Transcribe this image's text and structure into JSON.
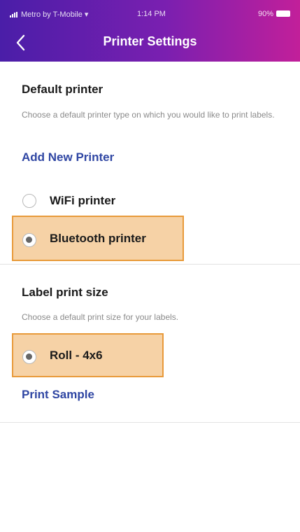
{
  "status_bar": {
    "carrier": "Metro by T-Mobile",
    "time": "1:14 PM",
    "battery": "90%"
  },
  "header": {
    "title": "Printer Settings"
  },
  "default_printer": {
    "heading": "Default printer",
    "description": "Choose a default printer type on which you would like to print labels.",
    "add_link": "Add New Printer",
    "options": [
      {
        "label": "WiFi printer",
        "selected": false
      },
      {
        "label": "Bluetooth printer",
        "selected": true
      }
    ]
  },
  "label_size": {
    "heading": "Label print size",
    "description": "Choose a default print size for your labels.",
    "options": [
      {
        "label": "Roll - 4x6",
        "selected": true
      }
    ],
    "sample_link": "Print Sample"
  },
  "colors": {
    "header_start": "#4a1ea8",
    "header_end": "#c21f9a",
    "link": "#2f46a3",
    "highlight_fill": "#f6d2a6",
    "highlight_border": "#e89a3a"
  }
}
